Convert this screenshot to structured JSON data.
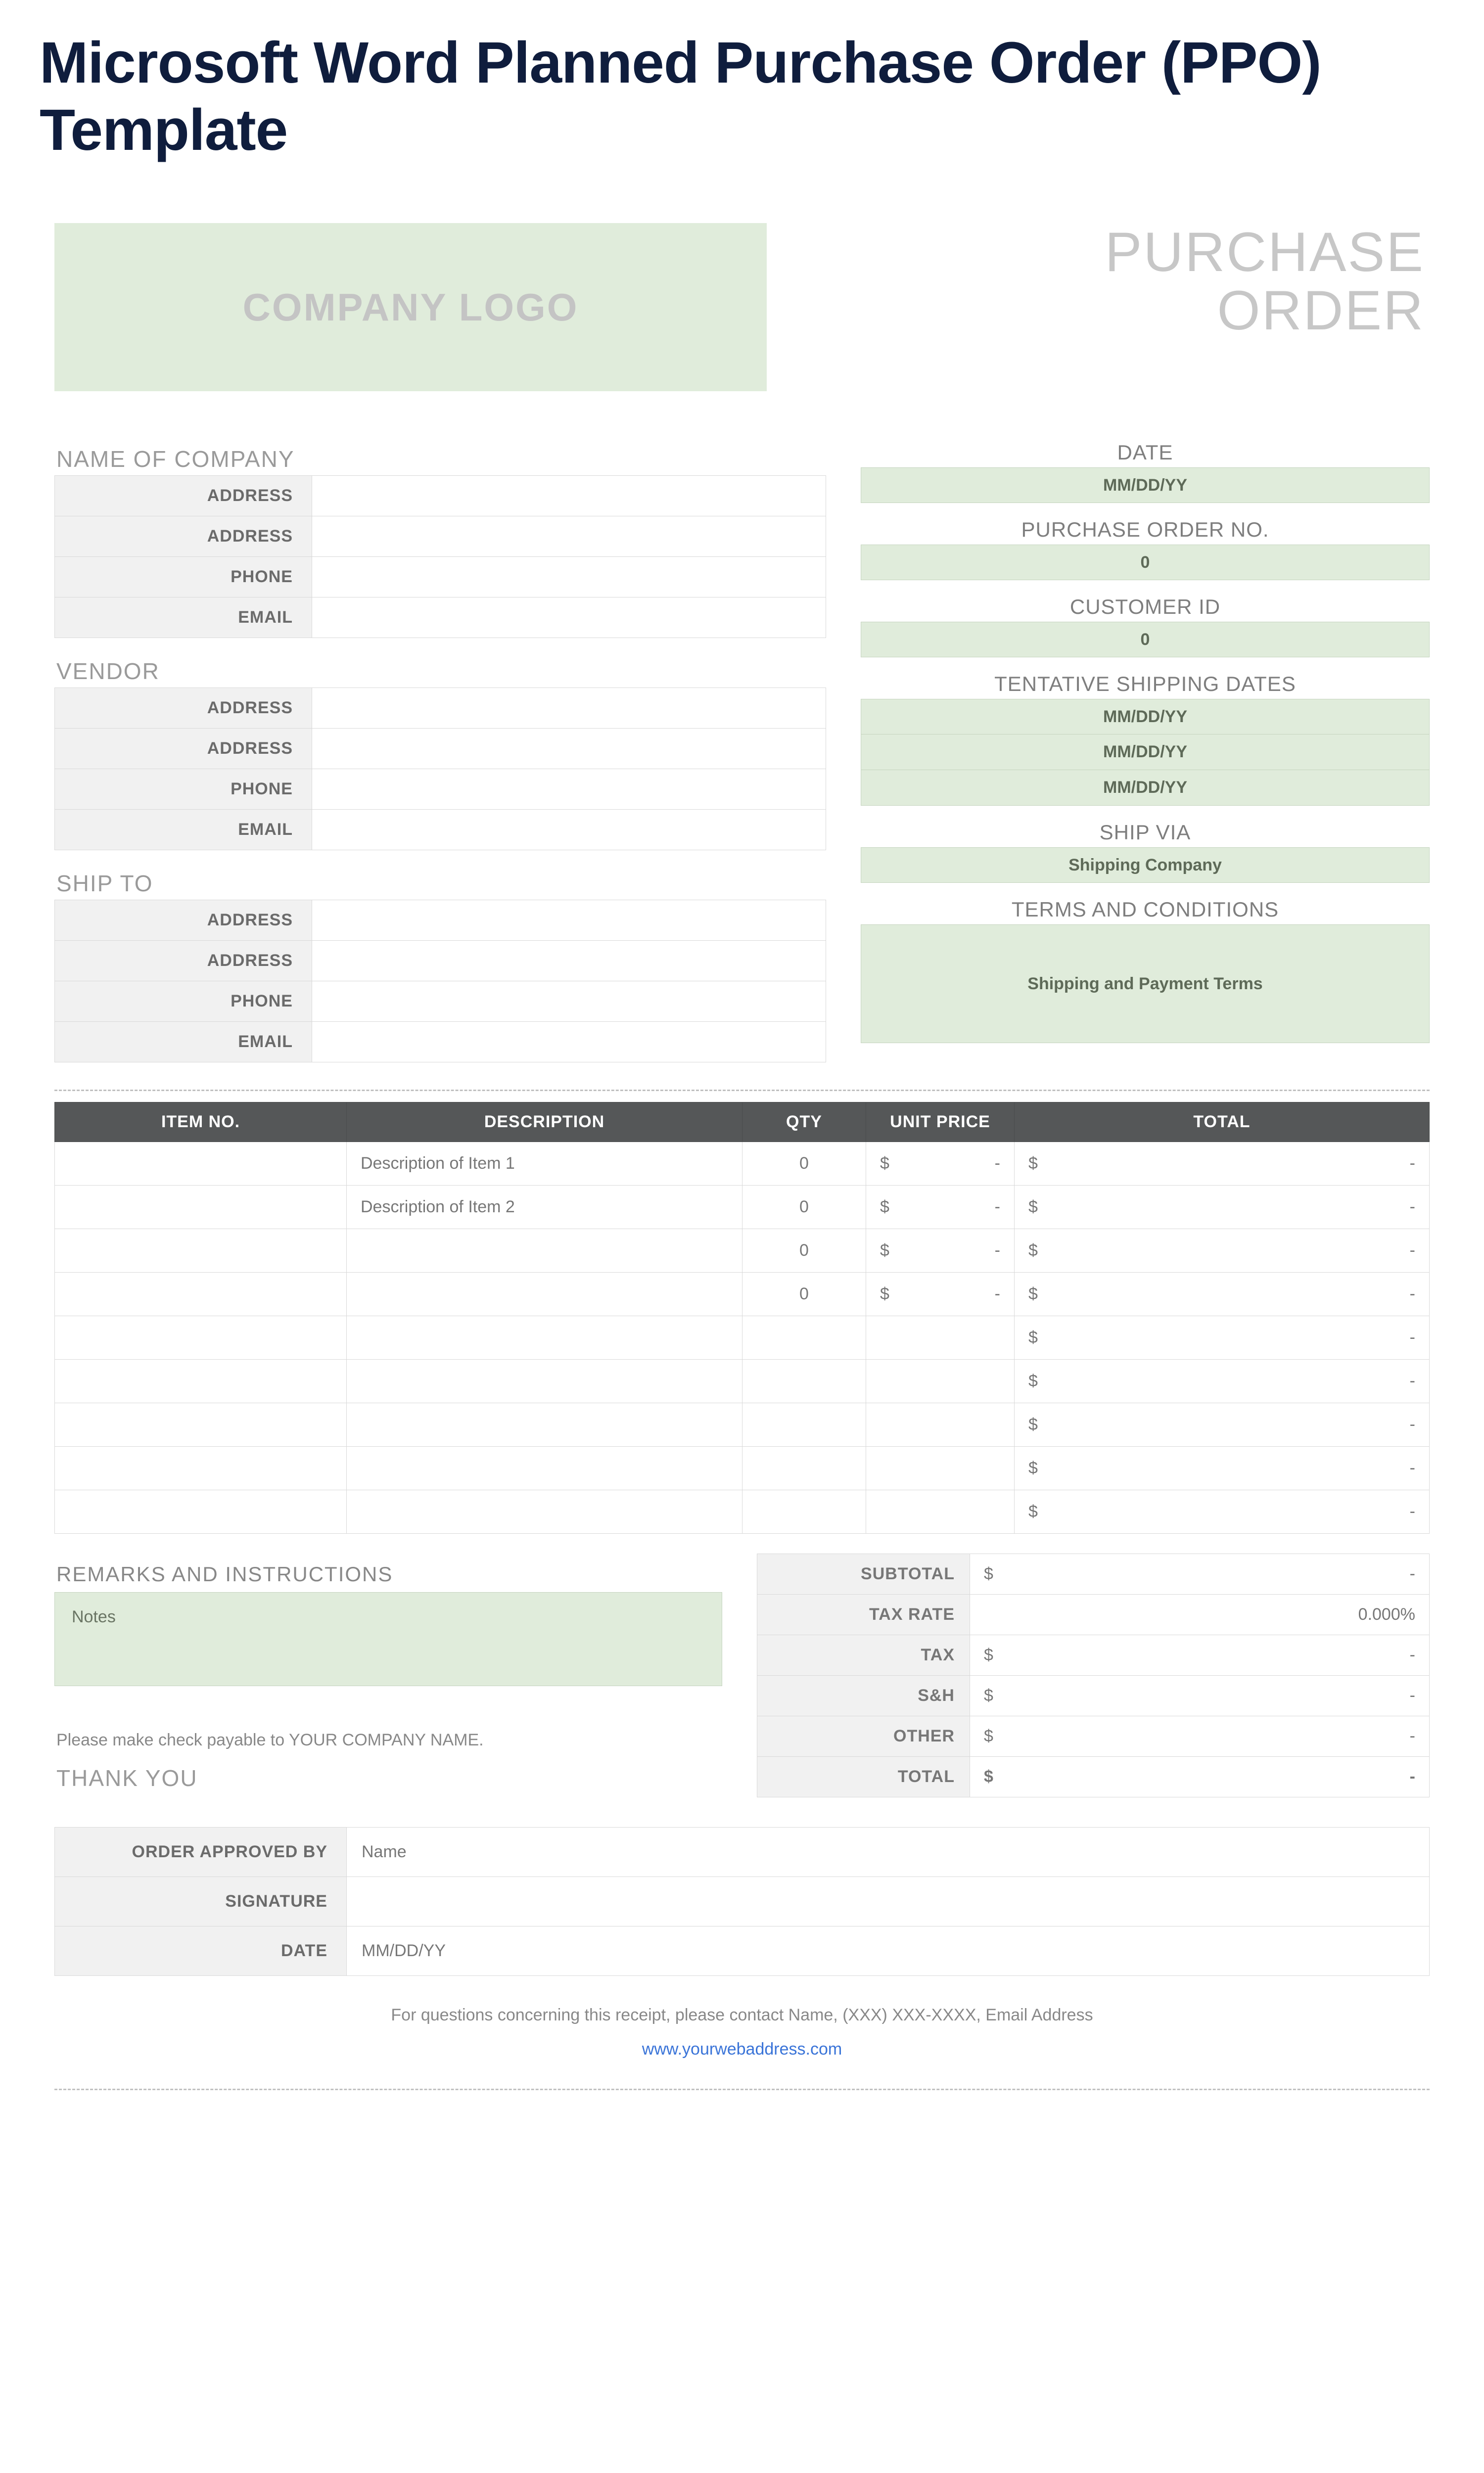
{
  "page_title": "Microsoft Word Planned Purchase Order (PPO) Template",
  "logo_placeholder": "COMPANY LOGO",
  "po_title_line1": "PURCHASE",
  "po_title_line2": "ORDER",
  "company": {
    "section_label": "NAME OF COMPANY",
    "fields": [
      {
        "label": "ADDRESS",
        "value": ""
      },
      {
        "label": "ADDRESS",
        "value": ""
      },
      {
        "label": "PHONE",
        "value": ""
      },
      {
        "label": "EMAIL",
        "value": ""
      }
    ]
  },
  "vendor": {
    "section_label": "VENDOR",
    "fields": [
      {
        "label": "ADDRESS",
        "value": ""
      },
      {
        "label": "ADDRESS",
        "value": ""
      },
      {
        "label": "PHONE",
        "value": ""
      },
      {
        "label": "EMAIL",
        "value": ""
      }
    ]
  },
  "ship_to": {
    "section_label": "SHIP TO",
    "fields": [
      {
        "label": "ADDRESS",
        "value": ""
      },
      {
        "label": "ADDRESS",
        "value": ""
      },
      {
        "label": "PHONE",
        "value": ""
      },
      {
        "label": "EMAIL",
        "value": ""
      }
    ]
  },
  "meta": {
    "date_label": "DATE",
    "date_value": "MM/DD/YY",
    "po_no_label": "PURCHASE ORDER NO.",
    "po_no_value": "0",
    "customer_id_label": "CUSTOMER ID",
    "customer_id_value": "0",
    "ship_dates_label": "TENTATIVE SHIPPING DATES",
    "ship_dates": [
      "MM/DD/YY",
      "MM/DD/YY",
      "MM/DD/YY"
    ],
    "ship_via_label": "SHIP VIA",
    "ship_via_value": "Shipping Company",
    "terms_label": "TERMS AND CONDITIONS",
    "terms_value": "Shipping and Payment Terms"
  },
  "items_header": {
    "item_no": "ITEM NO.",
    "description": "DESCRIPTION",
    "qty": "QTY",
    "unit_price": "UNIT PRICE",
    "total": "TOTAL"
  },
  "items": [
    {
      "item_no": "",
      "description": "Description of Item 1",
      "qty": "0",
      "unit_price_sym": "$",
      "unit_price_val": "-",
      "total_sym": "$",
      "total_val": "-"
    },
    {
      "item_no": "",
      "description": "Description of Item 2",
      "qty": "0",
      "unit_price_sym": "$",
      "unit_price_val": "-",
      "total_sym": "$",
      "total_val": "-"
    },
    {
      "item_no": "",
      "description": "",
      "qty": "0",
      "unit_price_sym": "$",
      "unit_price_val": "-",
      "total_sym": "$",
      "total_val": "-"
    },
    {
      "item_no": "",
      "description": "",
      "qty": "0",
      "unit_price_sym": "$",
      "unit_price_val": "-",
      "total_sym": "$",
      "total_val": "-"
    },
    {
      "item_no": "",
      "description": "",
      "qty": "",
      "unit_price_sym": "",
      "unit_price_val": "",
      "total_sym": "$",
      "total_val": "-"
    },
    {
      "item_no": "",
      "description": "",
      "qty": "",
      "unit_price_sym": "",
      "unit_price_val": "",
      "total_sym": "$",
      "total_val": "-"
    },
    {
      "item_no": "",
      "description": "",
      "qty": "",
      "unit_price_sym": "",
      "unit_price_val": "",
      "total_sym": "$",
      "total_val": "-"
    },
    {
      "item_no": "",
      "description": "",
      "qty": "",
      "unit_price_sym": "",
      "unit_price_val": "",
      "total_sym": "$",
      "total_val": "-"
    },
    {
      "item_no": "",
      "description": "",
      "qty": "",
      "unit_price_sym": "",
      "unit_price_val": "",
      "total_sym": "$",
      "total_val": "-"
    }
  ],
  "remarks": {
    "title": "REMARKS AND INSTRUCTIONS",
    "notes_placeholder": "Notes",
    "payable_note": "Please make check payable to YOUR COMPANY NAME.",
    "thank_you": "THANK YOU"
  },
  "totals": {
    "rows": [
      {
        "label": "SUBTOTAL",
        "sym": "$",
        "val": "-"
      },
      {
        "label": "TAX RATE",
        "sym": "",
        "val": "0.000%"
      },
      {
        "label": "TAX",
        "sym": "$",
        "val": "-"
      },
      {
        "label": "S&H",
        "sym": "$",
        "val": "-"
      },
      {
        "label": "OTHER",
        "sym": "$",
        "val": "-"
      }
    ],
    "total_label": "TOTAL",
    "total_sym": "$",
    "total_val": "-"
  },
  "approval": {
    "rows": [
      {
        "label": "ORDER APPROVED BY",
        "value": "Name"
      },
      {
        "label": "SIGNATURE",
        "value": ""
      },
      {
        "label": "DATE",
        "value": "MM/DD/YY"
      }
    ]
  },
  "footer": {
    "note": "For questions concerning this receipt, please contact Name, (XXX) XXX-XXXX, Email Address",
    "link": "www.yourwebaddress.com"
  }
}
